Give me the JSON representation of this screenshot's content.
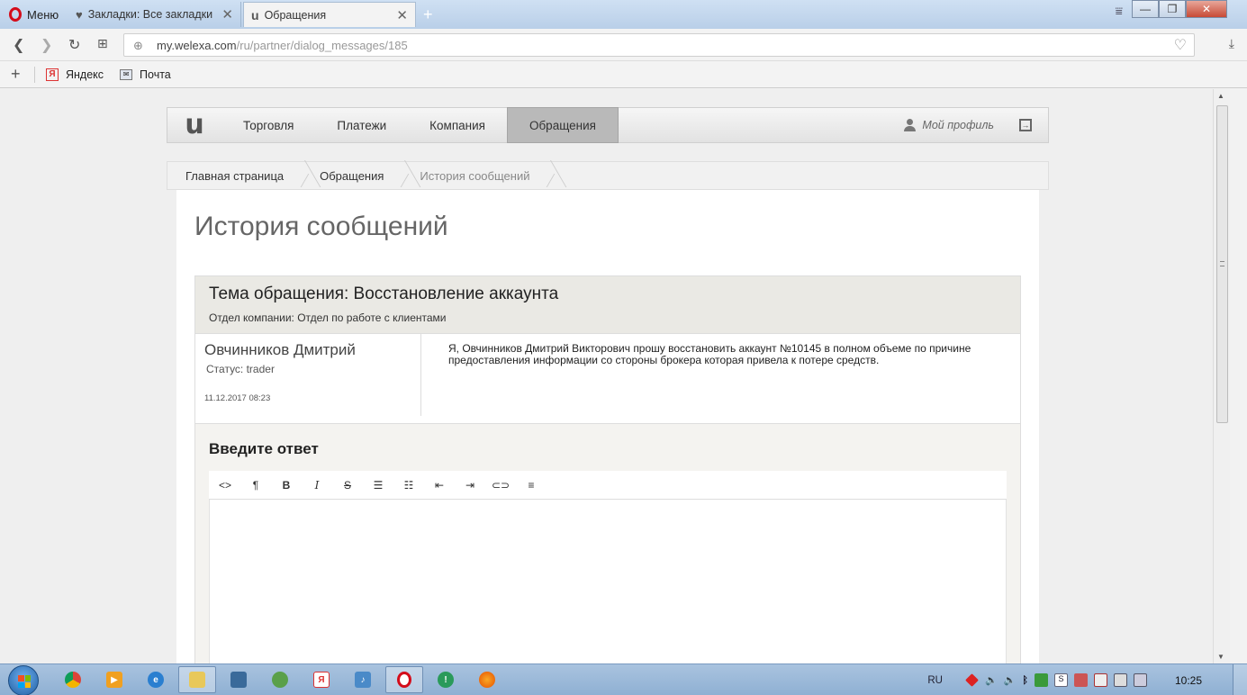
{
  "browser": {
    "menu_label": "Меню",
    "tabs": [
      {
        "title": "Закладки: Все закладки",
        "icon": "heart-icon"
      },
      {
        "title": "Обращения",
        "icon": "site-logo-icon"
      }
    ],
    "url_host": "my.welexa.com",
    "url_path": "/ru/partner/dialog_messages/185",
    "bookmarks": [
      {
        "label": "Яндекс",
        "icon": "yandex-icon"
      },
      {
        "label": "Почта",
        "icon": "mail-icon"
      }
    ]
  },
  "site": {
    "logo": "u",
    "nav": [
      "Торговля",
      "Платежи",
      "Компания",
      "Обращения"
    ],
    "active_nav": "Обращения",
    "profile_label": "Мой профиль",
    "breadcrumbs": [
      "Главная страница",
      "Обращения",
      "История сообщений"
    ]
  },
  "page": {
    "title": "История сообщений",
    "ticket": {
      "subject": "Тема обращения: Восстановление аккаунта",
      "department": "Отдел компании: Отдел по работе с клиентами",
      "message": {
        "author": "Овчинников Дмитрий",
        "status": "Статус: trader",
        "date": "11.12.2017 08:23",
        "text": "Я, Овчинников Дмитрий Викторович прошу восстановить аккаунт №10145 в полном объеме по причине предоставления информации со стороны брокера которая привела к потере средств."
      }
    },
    "reply": {
      "title": "Введите ответ",
      "toolbar": [
        {
          "name": "html-source-button",
          "glyph": "<>"
        },
        {
          "name": "paragraph-button",
          "glyph": "¶"
        },
        {
          "name": "bold-button",
          "glyph": "B"
        },
        {
          "name": "italic-button",
          "glyph": "I"
        },
        {
          "name": "strikethrough-button",
          "glyph": "S"
        },
        {
          "name": "unordered-list-button",
          "glyph": "☰"
        },
        {
          "name": "ordered-list-button",
          "glyph": "☷"
        },
        {
          "name": "outdent-button",
          "glyph": "⇤"
        },
        {
          "name": "indent-button",
          "glyph": "⇥"
        },
        {
          "name": "link-button",
          "glyph": "⊂⊃"
        },
        {
          "name": "align-button",
          "glyph": "≡"
        }
      ]
    }
  },
  "taskbar": {
    "lang": "RU",
    "time": "10:25"
  }
}
